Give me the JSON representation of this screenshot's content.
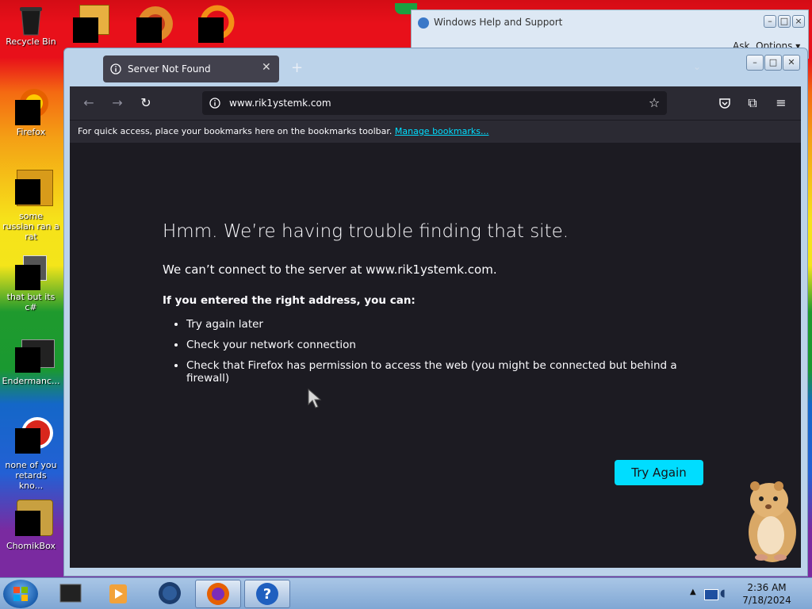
{
  "desktop": {
    "icons": [
      {
        "label": "Recycle Bin"
      },
      {
        "label": "Firefox"
      },
      {
        "label": "some russian ran a rat"
      },
      {
        "label": "that but its c#"
      },
      {
        "label": "Endermanc..."
      },
      {
        "label": "none of you retards kno..."
      },
      {
        "label": "ChomikBox"
      }
    ]
  },
  "help_window": {
    "title": "Windows Help and Support",
    "ask": "Ask",
    "options": "Options"
  },
  "browser": {
    "tab_title": "Server Not Found",
    "url": "www.rik1ystemk.com",
    "bookmarks_text": "For quick access, place your bookmarks here on the bookmarks toolbar.",
    "bookmarks_link": "Manage bookmarks...",
    "error": {
      "title": "Hmm. We’re having trouble finding that site.",
      "message": "We can’t connect to the server at www.rik1ystemk.com.",
      "subtitle": "If you entered the right address, you can:",
      "items": [
        "Try again later",
        "Check your network connection",
        "Check that Firefox has permission to access the web (you might be connected but behind a firewall)"
      ],
      "button": "Try Again"
    }
  },
  "taskbar": {
    "time": "2:36 AM",
    "date": "7/18/2024"
  },
  "colors": {
    "accent": "#00ddff",
    "page_bg": "#1c1b22",
    "toolbar_bg": "#2b2a33"
  }
}
